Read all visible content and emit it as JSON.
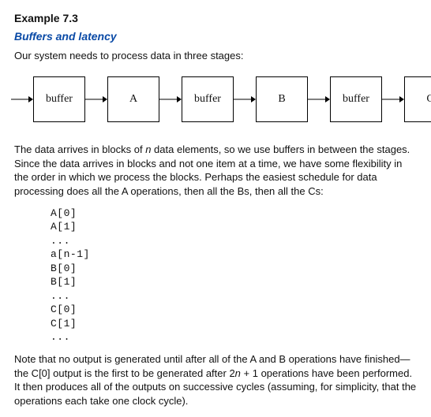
{
  "example_number": "Example 7.3",
  "title": "Buffers and latency",
  "intro": "Our system needs to process data in three stages:",
  "diagram": {
    "blocks": [
      {
        "label": "buffer",
        "kind": "buffer"
      },
      {
        "label": "A",
        "kind": "stage"
      },
      {
        "label": "buffer",
        "kind": "buffer"
      },
      {
        "label": "B",
        "kind": "stage"
      },
      {
        "label": "buffer",
        "kind": "buffer"
      },
      {
        "label": "C",
        "kind": "stage"
      }
    ]
  },
  "para1_pre": "The data arrives in blocks of ",
  "para1_n": "n",
  "para1_post": " data elements, so we use buffers in between the stages. Since the data arrives in blocks and not one item at a time, we have some flexibility in the order in which we process the blocks. Perhaps the easiest schedule for data processing does all the A operations, then all the Bs, then all the Cs:",
  "codelines": [
    "A[0]",
    "A[1]",
    "...",
    "a[n-1]",
    "B[0]",
    "B[1]",
    "...",
    "C[0]",
    "C[1]",
    "..."
  ],
  "note_pre": "Note that no output is generated until after all of the A and B operations have finished—the C[0] output is the first to be generated after 2",
  "note_n": "n",
  "note_post": " + 1 operations have been performed. It then produces all of the outputs on successive cycles (assuming, for simplicity, that the operations each take one clock cycle)."
}
